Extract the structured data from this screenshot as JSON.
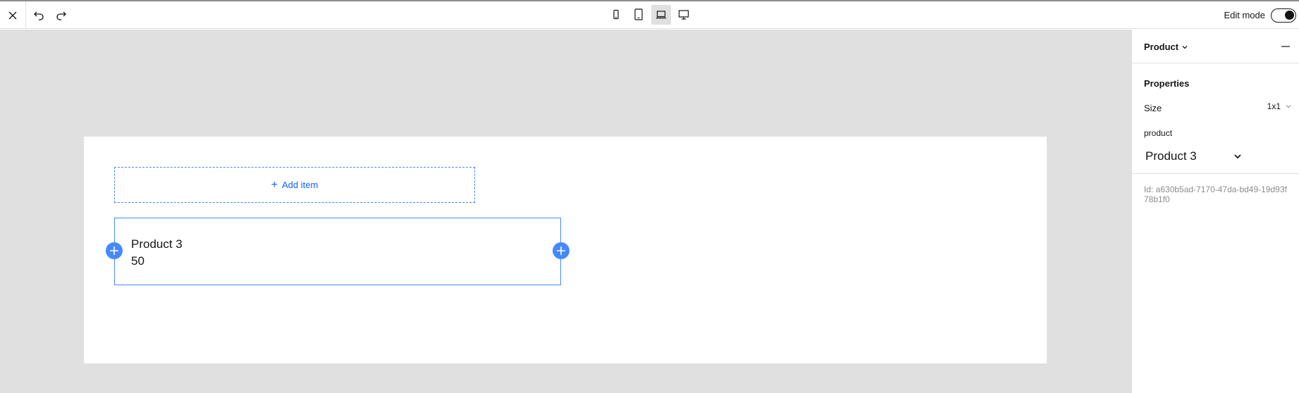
{
  "toolbar": {
    "close_icon": "close-icon",
    "undo_icon": "undo-icon",
    "redo_icon": "redo-icon",
    "devices": [
      "mobile",
      "tablet",
      "laptop",
      "desktop"
    ],
    "active_device": "laptop",
    "edit_mode_label": "Edit mode",
    "edit_mode_on": true
  },
  "canvas": {
    "add_item_label": "Add item",
    "card": {
      "title": "Product 3",
      "value": "50"
    }
  },
  "panel": {
    "title": "Product",
    "properties_heading": "Properties",
    "size_label": "Size",
    "size_value": "1x1",
    "product_label": "product",
    "product_value": "Product 3",
    "id_text": "Id: a630b5ad-7170-47da-bd49-19d93f78b1f0"
  },
  "colors": {
    "accent": "#4589ff",
    "link": "#0f62fe",
    "canvas_bg": "#e0e0e0",
    "muted_text": "#8d8d8d"
  }
}
